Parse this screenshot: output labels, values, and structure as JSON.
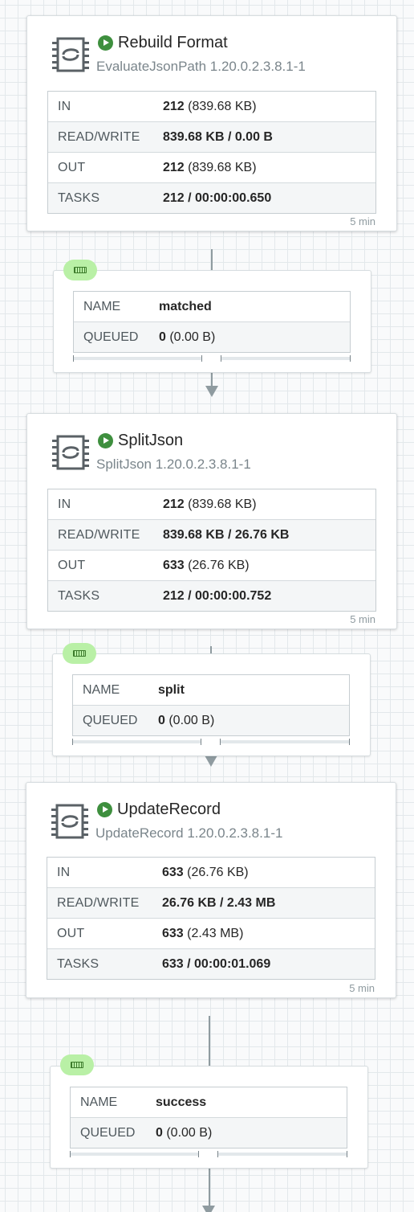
{
  "processors": [
    {
      "name": "Rebuild Format",
      "type": "EvaluateJsonPath 1.20.0.2.3.8.1-1",
      "status": "running",
      "stats": [
        {
          "label": "IN",
          "value_bold": "212",
          "value_rest": " (839.68 KB)"
        },
        {
          "label": "READ/WRITE",
          "value_bold": "839.68 KB / 0.00 B",
          "value_rest": ""
        },
        {
          "label": "OUT",
          "value_bold": "212",
          "value_rest": " (839.68 KB)"
        },
        {
          "label": "TASKS",
          "value_bold": "212 / 00:00:00.650",
          "value_rest": ""
        }
      ],
      "time_window": "5 min"
    },
    {
      "name": "SplitJson",
      "type": "SplitJson 1.20.0.2.3.8.1-1",
      "status": "running",
      "stats": [
        {
          "label": "IN",
          "value_bold": "212",
          "value_rest": " (839.68 KB)"
        },
        {
          "label": "READ/WRITE",
          "value_bold": "839.68 KB / 26.76 KB",
          "value_rest": ""
        },
        {
          "label": "OUT",
          "value_bold": "633",
          "value_rest": " (26.76 KB)"
        },
        {
          "label": "TASKS",
          "value_bold": "212 / 00:00:00.752",
          "value_rest": ""
        }
      ],
      "time_window": "5 min"
    },
    {
      "name": "UpdateRecord",
      "type": "UpdateRecord 1.20.0.2.3.8.1-1",
      "status": "running",
      "stats": [
        {
          "label": "IN",
          "value_bold": "633",
          "value_rest": " (26.76 KB)"
        },
        {
          "label": "READ/WRITE",
          "value_bold": "26.76 KB / 2.43 MB",
          "value_rest": ""
        },
        {
          "label": "OUT",
          "value_bold": "633",
          "value_rest": " (2.43 MB)"
        },
        {
          "label": "TASKS",
          "value_bold": "633 / 00:00:01.069",
          "value_rest": ""
        }
      ],
      "time_window": "5 min"
    }
  ],
  "connections": [
    {
      "name_label": "NAME",
      "name": "matched",
      "queued_label": "QUEUED",
      "queued_count": "0",
      "queued_size": " (0.00 B)"
    },
    {
      "name_label": "NAME",
      "name": "split",
      "queued_label": "QUEUED",
      "queued_count": "0",
      "queued_size": " (0.00 B)"
    },
    {
      "name_label": "NAME",
      "name": "success",
      "queued_label": "QUEUED",
      "queued_count": "0",
      "queued_size": " (0.00 B)"
    }
  ],
  "colors": {
    "running": "#3e8f3e",
    "queue_badge": "#b9f0a6",
    "connection_line": "#8f9ba0"
  },
  "icons": {
    "processor": "processor-icon",
    "status": "run-icon",
    "queue": "queue-icon"
  }
}
